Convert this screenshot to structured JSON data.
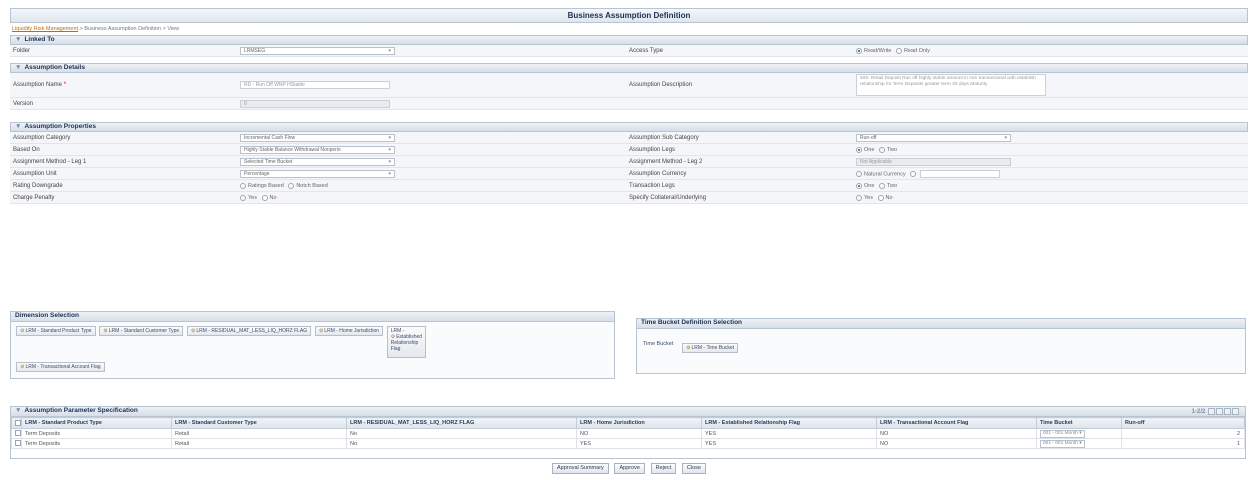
{
  "page_title": "Business Assumption Definition",
  "breadcrumb": {
    "link": "Liquidity Risk Management",
    "rest": " > Business Assumption Definition > View"
  },
  "linked_to": {
    "heading": "Linked To",
    "folder_label": "Folder",
    "folder_value": "LRMSEG",
    "access_label": "Access Type",
    "access_options": [
      "Read/Write",
      "Read Only"
    ],
    "access_selected": "Read/Write"
  },
  "assumption_details": {
    "heading": "Assumption Details",
    "name_label": "Assumption Name",
    "name_value": "RD - Run Off WNP HStable",
    "desc_label": "Assumption Description",
    "desc_value": "505- Retail Deposit Run off highly stable amount in non transactional with establish relationship for Term Deposits greater term 30 days Maturity",
    "version_label": "Version",
    "version_value": "0"
  },
  "assumption_properties": {
    "heading": "Assumption Properties",
    "rows": [
      {
        "l1": "Assumption Category",
        "v1": "Incremental Cash Flow",
        "l2": "Assumption Sub Category",
        "v2": "Run-off"
      },
      {
        "l1": "Based On",
        "v1": "Highly Stable Balance Withdrawal Nonperio",
        "l2": "Assumption Legs",
        "r2": [
          "One",
          "Two"
        ]
      },
      {
        "l1": "Assignment Method - Leg 1",
        "v1": "Selected Time Bucket",
        "l2": "Assignment Method - Leg 2",
        "v2": "Not Applicable"
      },
      {
        "l1": "Assumption Unit",
        "v1": "Percentage",
        "l2": "Assumption Currency",
        "r2": [
          "Natural Currency",
          ""
        ]
      },
      {
        "l1": "Rating Downgrade",
        "r1": [
          "Ratings Based",
          "Notch Based"
        ],
        "l2": "Transaction Legs",
        "r2": [
          "One",
          "Two"
        ]
      },
      {
        "l1": "Charge Penalty",
        "r1": [
          "Yes",
          "No"
        ],
        "l2": "Specify Collateral/Underlying",
        "r2": [
          "Yes",
          "No"
        ]
      }
    ]
  },
  "dimension_selection": {
    "heading": "Dimension Selection",
    "tags": [
      "LRM - Standard Product Type",
      "LRM - Standard Customer Type",
      "LRM - RESIDUAL_MAT_LESS_LIQ_HORZ FLAG",
      "LRM - Home Jurisdiction",
      "LRM - Transactional Account Flag"
    ],
    "stacked_tag": [
      "LRM -",
      "Established",
      "Relationship",
      "Flag"
    ]
  },
  "time_bucket_selection": {
    "heading": "Time Bucket Definition Selection",
    "label": "Time Bucket",
    "tag": "LRM - Time Bucket"
  },
  "param_spec": {
    "heading": "Assumption Parameter Specification",
    "pager": "1-2/2",
    "columns": [
      "LRM - Standard Product Type",
      "LRM - Standard Customer Type",
      "LRM - RESIDUAL_MAT_LESS_LIQ_HORZ FLAG",
      "LRM - Home Jurisdiction",
      "LRM - Established Relationship Flag",
      "LRM - Transactional Account Flag",
      "Time Bucket",
      "Run-off"
    ],
    "rows": [
      [
        "Term Deposits",
        "Retail",
        "No",
        "NO",
        "YES",
        "NO",
        "001 - 001 Month",
        "2"
      ],
      [
        "Term Deposits",
        "Retail",
        "No",
        "YES",
        "YES",
        "NO",
        "001 - 001 Month",
        "1"
      ]
    ]
  },
  "buttons": [
    "Approval Summary",
    "Approve",
    "Reject",
    "Close"
  ]
}
